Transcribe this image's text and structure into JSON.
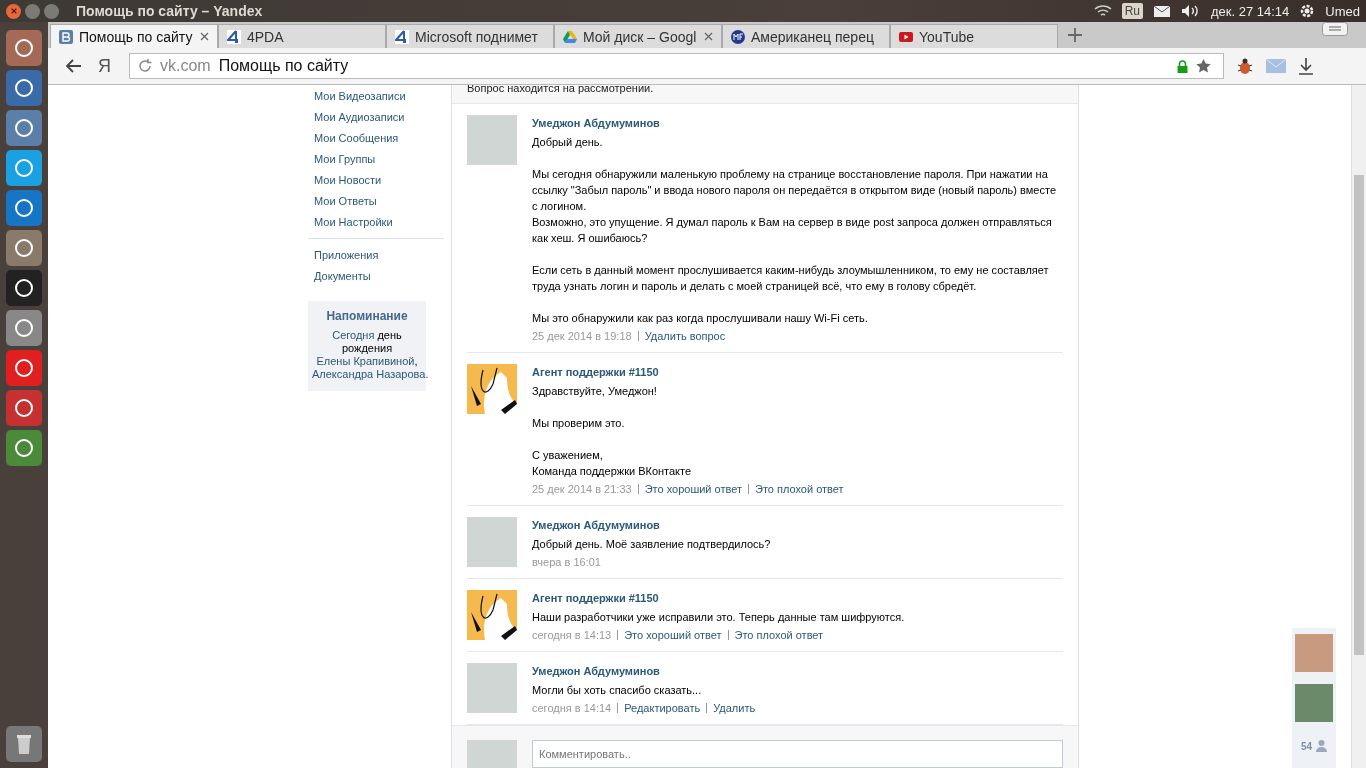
{
  "window": {
    "title": "Помощь по сайту – Yandex"
  },
  "system_tray": {
    "language": "Ru",
    "clock": "дек. 27 14:14",
    "user": "Umed"
  },
  "tabs": [
    {
      "title": "Помощь по сайту",
      "kind": "vk",
      "selected": true,
      "close_visible": true
    },
    {
      "title": "4PDA",
      "kind": "pda",
      "selected": false,
      "close_visible": false
    },
    {
      "title": "Microsoft поднимет",
      "kind": "pda",
      "selected": false,
      "close_visible": false
    },
    {
      "title": "Мой диск – Googl",
      "kind": "drive",
      "selected": false,
      "close_visible": true
    },
    {
      "title": "Американец перец",
      "kind": "mf",
      "selected": false,
      "close_visible": false
    },
    {
      "title": "YouTube",
      "kind": "youtube",
      "selected": false,
      "close_visible": false
    }
  ],
  "toolbar": {
    "logo": "Я",
    "domain": "vk.com",
    "page_title": "Помощь по сайту"
  },
  "sidebar": {
    "items": [
      "Мои Видеозаписи",
      "Мои Аудиозаписи",
      "Мои Сообщения",
      "Мои Группы",
      "Мои Новости",
      "Мои Ответы",
      "Мои Настройки"
    ],
    "items_2": [
      "Приложения",
      "Документы"
    ],
    "reminder": {
      "title": "Напоминание",
      "parts": [
        {
          "text": "Сегодня",
          "link": true
        },
        {
          "text": " день рождения ",
          "link": false
        },
        {
          "text": "Елены ",
          "link": true
        },
        {
          "text": "Крапивиной",
          "link": true
        },
        {
          "text": ", ",
          "link": false
        },
        {
          "text": "Александра ",
          "link": true
        },
        {
          "text": "Назарова.",
          "link": true
        }
      ]
    }
  },
  "question": {
    "status": "Вопрос находится на рассмотрении.",
    "messages": [
      {
        "kind": "user",
        "author": "Умеджон Абдумуминов",
        "text": "Добрый день.\n\nМы сегодня обнаружили маленькую проблему на странице восстановление пароля. При нажатии на ссылку \"Забыл пароль\" и ввода нового пароля он передаётся в открытом виде (новый пароль) вместе с логином.\nВозможно, это упущение. Я думал пароль к Вам на сервер в виде post запроса должен отправляться как хеш. Я ошибаюсь?\n\nЕсли сеть в данный момент прослушивается каким-нибудь злоумышленником, то ему не составляет труда узнать логин и пароль и делать с моей страницей всё, что ему в голову сбредёт.\n\nМы это обнаружили как раз когда прослушивали нашу Wi-Fi сеть.",
        "date": "25 дек 2014 в 19:18",
        "actions": [
          "Удалить вопрос"
        ]
      },
      {
        "kind": "agent",
        "author": "Агент поддержки #1150",
        "text": "Здравствуйте, Умеджон!\n\nМы проверим это.\n\nС уважением,\nКоманда поддержки ВКонтакте",
        "date": "25 дек 2014 в 21:33",
        "actions": [
          "Это хороший ответ",
          "Это плохой ответ"
        ]
      },
      {
        "kind": "user",
        "author": "Умеджон Абдумуминов",
        "text": "Добрый день. Моё заявление подтвердилось?",
        "date": "вчера в 16:01"
      },
      {
        "kind": "agent",
        "author": "Агент поддержки #1150",
        "text": "Наши разработчики уже исправили это. Теперь данные там шифруются.",
        "date": "сегодня в 14:13",
        "actions": [
          "Это хороший ответ",
          "Это плохой ответ"
        ]
      },
      {
        "kind": "user",
        "author": "Умеджон Абдумуминов",
        "text": "Могли бы хоть спасибо сказать...",
        "date": "сегодня в 14:14",
        "actions": [
          "Редактировать",
          "Удалить"
        ]
      }
    ],
    "comment": {
      "placeholder": "Комментировать.."
    }
  },
  "friends_panel": {
    "count": "54"
  }
}
